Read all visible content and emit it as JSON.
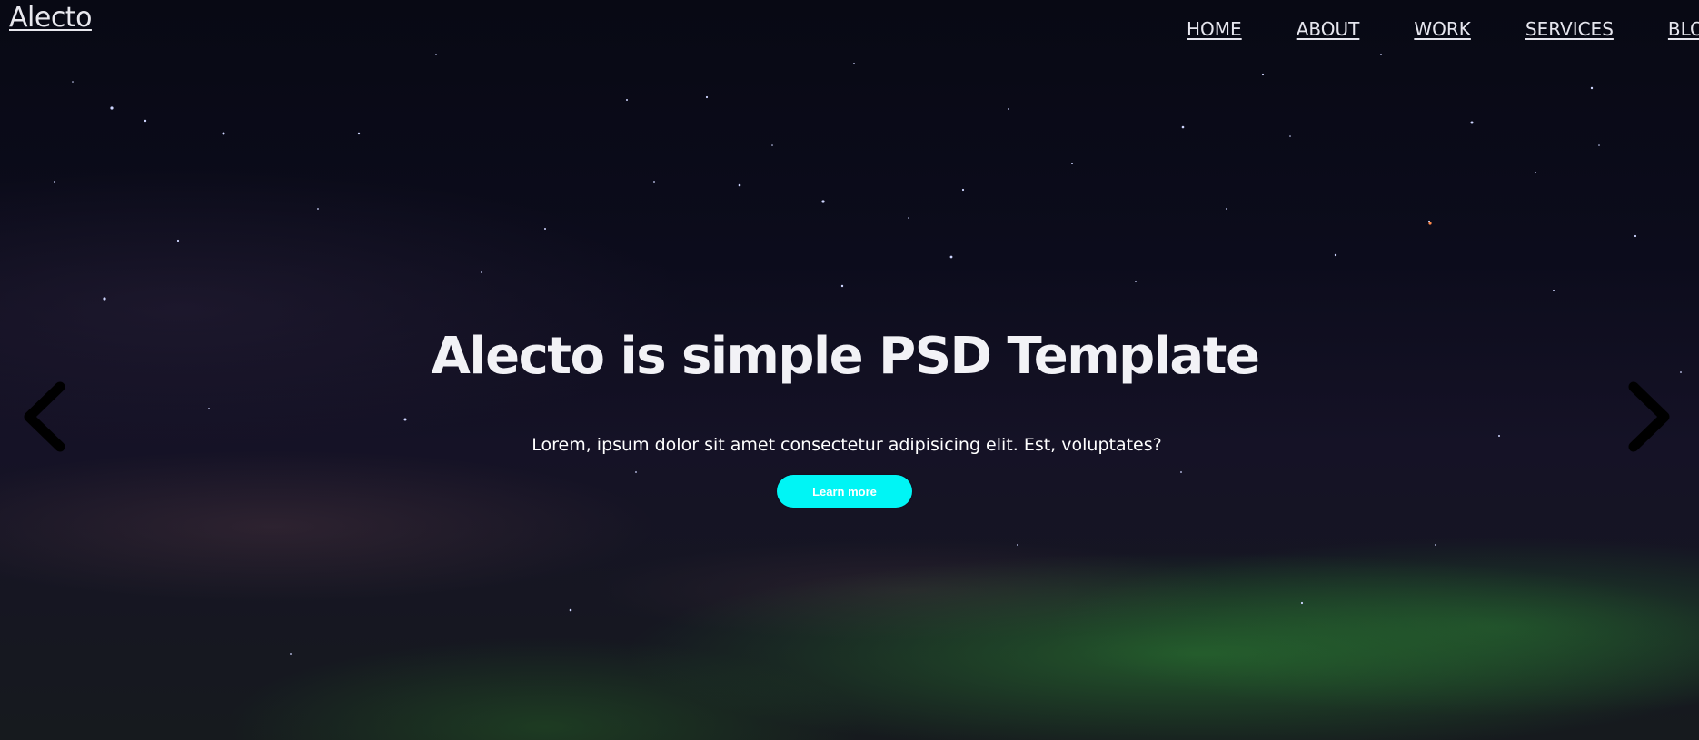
{
  "header": {
    "brand": "Alecto",
    "nav": [
      {
        "label": "HOME"
      },
      {
        "label": "ABOUT"
      },
      {
        "label": "WORK"
      },
      {
        "label": "SERVICES"
      },
      {
        "label": "BLO"
      }
    ]
  },
  "hero": {
    "title": "Alecto is simple PSD Template",
    "subtitle": "Lorem, ipsum dolor sit amet consectetur adipisicing elit. Est, voluptates?",
    "cta_label": "Learn more",
    "cta_color": "#00f5f5"
  },
  "carousel": {
    "prev_icon": "chevron-left-icon",
    "next_icon": "chevron-right-icon"
  }
}
